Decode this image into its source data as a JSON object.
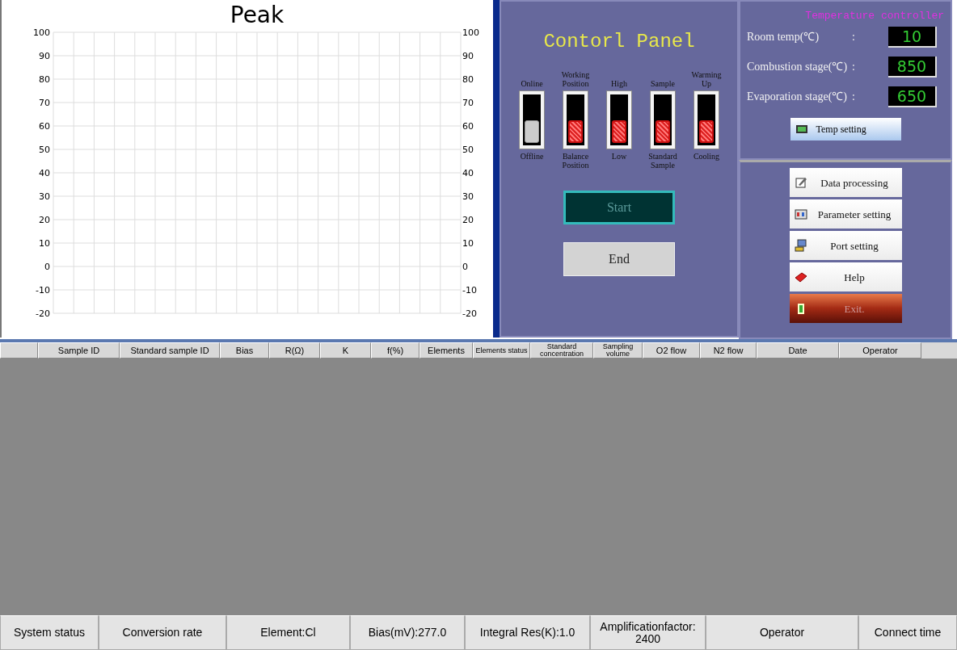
{
  "chart": {
    "title": "Peak",
    "left_axis_labels": [
      "100",
      "90",
      "80",
      "70",
      "60",
      "50",
      "40",
      "30",
      "20",
      "10",
      "0",
      "-10",
      "-20"
    ],
    "right_axis_labels": [
      "100",
      "90",
      "80",
      "70",
      "60",
      "50",
      "40",
      "30",
      "20",
      "10",
      "0",
      "-10",
      "-20"
    ]
  },
  "control_panel": {
    "title": "Contorl Panel",
    "switches": [
      {
        "top_label": "Online",
        "bottom_label": "Offline",
        "on": false
      },
      {
        "top_label": "Working Position",
        "bottom_label": "Balance Position",
        "on": true
      },
      {
        "top_label": "High",
        "bottom_label": "Low",
        "on": true
      },
      {
        "top_label": "Sample",
        "bottom_label": "Standard Sample",
        "on": true
      },
      {
        "top_label": "Warming Up",
        "bottom_label": "Cooling",
        "on": true
      }
    ],
    "buttons": [
      {
        "label": "Start",
        "kind": "dark"
      },
      {
        "label": "End",
        "kind": "light"
      }
    ]
  },
  "temperature_controller": {
    "title": "Temperature controller",
    "readings": [
      {
        "label": "Room temp(℃)",
        "separator": ":",
        "value": "10"
      },
      {
        "label": "Combustion stage(℃)",
        "separator": ":",
        "value": "850"
      },
      {
        "label": "Evaporation stage(℃)",
        "separator": ":",
        "value": "650"
      }
    ],
    "button": "Temp setting"
  },
  "actions": [
    {
      "label": "Data processing",
      "kind": "edit"
    },
    {
      "label": "Parameter setting",
      "kind": "params"
    },
    {
      "label": "Port setting",
      "kind": "port"
    },
    {
      "label": "Help",
      "kind": "help"
    },
    {
      "label": "Exit.",
      "kind": "exit"
    }
  ],
  "table": {
    "columns": [
      "Sample ID",
      "Standard sample ID",
      "Bias",
      "R(Ω)",
      "K",
      "f(%)",
      "Elements",
      "Elements status",
      "Standard concentration",
      "Sampling volume",
      "O2 flow",
      "N2 flow",
      "Date",
      "Operator"
    ]
  },
  "status_bar": [
    "System status",
    "Conversion rate",
    "Element:Cl",
    "Bias(mV):277.0",
    "Integral Res(K):1.0",
    "Amplificationfactor: 2400",
    "Operator",
    "Connect time"
  ]
}
